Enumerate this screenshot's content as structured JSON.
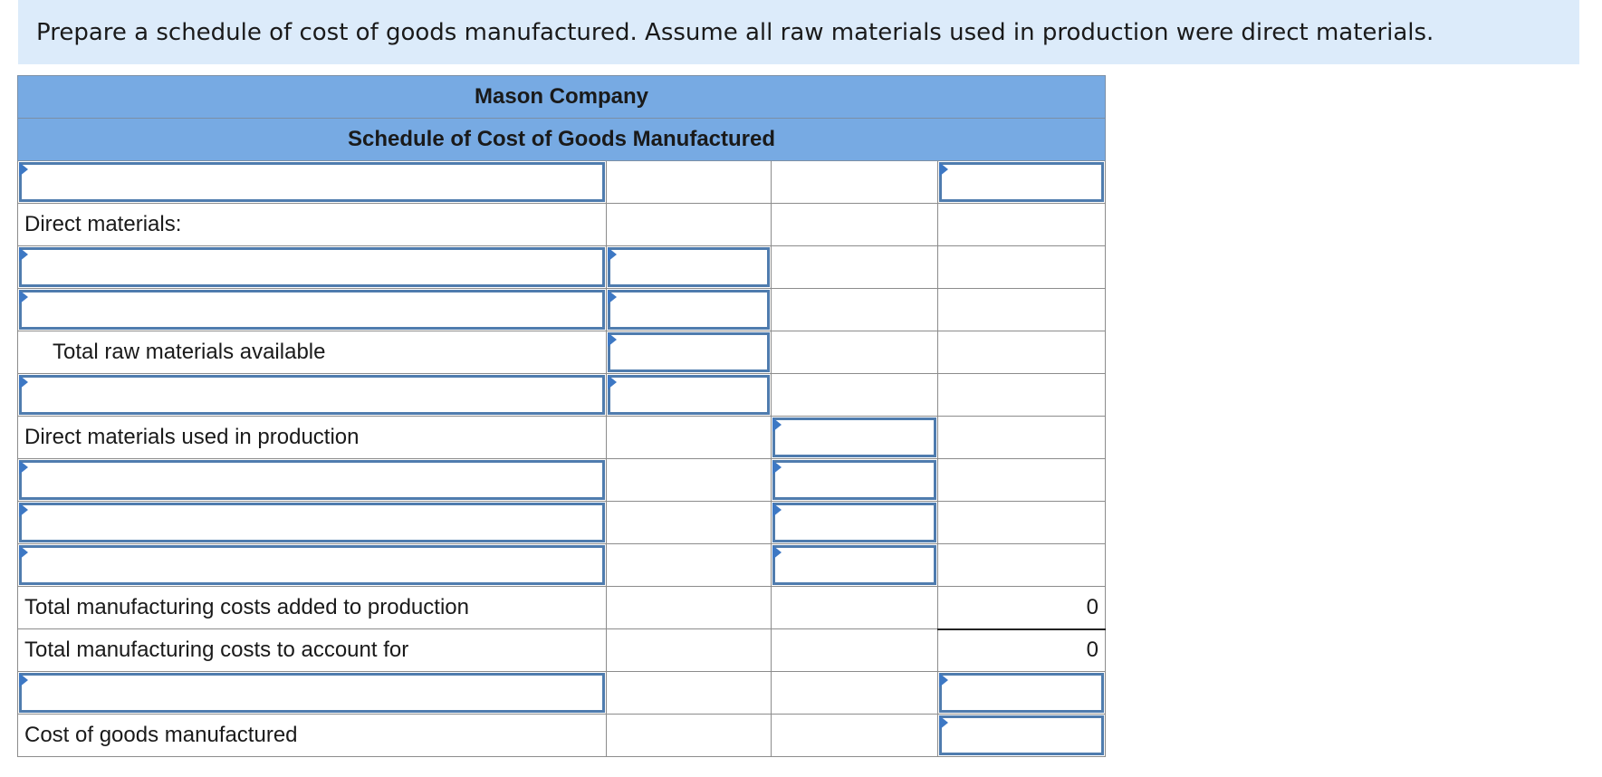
{
  "instructions": "Prepare a schedule of cost of goods manufactured. Assume all raw materials used in production were direct materials.",
  "schedule": {
    "company": "Mason Company",
    "title": "Schedule of Cost of Goods Manufactured",
    "labels": {
      "direct_materials": "Direct materials:",
      "total_raw_materials_available": "Total raw materials available",
      "direct_materials_used": "Direct materials used in production",
      "total_manufacturing_costs_added": "Total manufacturing costs added to production",
      "total_manufacturing_costs_to_account": "Total manufacturing costs to account for",
      "cost_of_goods_manufactured": "Cost of goods manufactured"
    },
    "values": {
      "total_manufacturing_costs_added": "0",
      "total_manufacturing_costs_to_account": "0"
    },
    "inputs": {
      "r1_label": "",
      "r1_col3": "",
      "r3_label": "",
      "r3_col1": "",
      "r4_label": "",
      "r4_col1": "",
      "r5_col1": "",
      "r6_label": "",
      "r6_col1": "",
      "r7_col2": "",
      "r8_label": "",
      "r8_col2": "",
      "r9_label": "",
      "r9_col2": "",
      "r10_label": "",
      "r10_col2": "",
      "r13_label": "",
      "r13_col3": "",
      "r14_col3": ""
    }
  }
}
